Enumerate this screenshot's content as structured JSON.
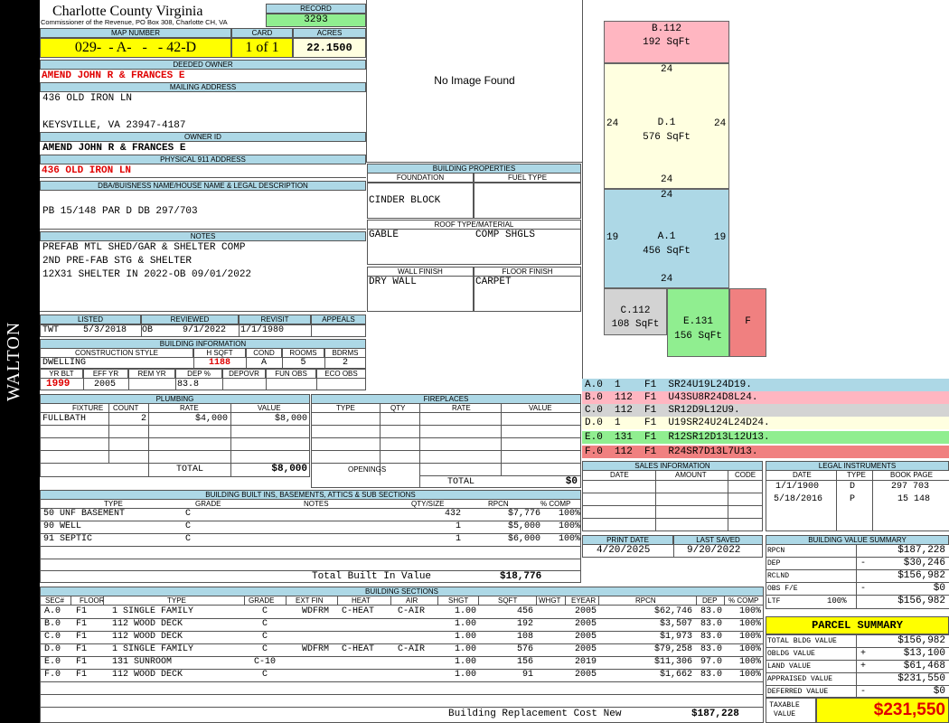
{
  "sidebar_label": "WALTON",
  "header": {
    "county": "Charlotte County Virginia",
    "office": "Commissioner of the Revenue, PO Box 308, Charlotte CH, VA",
    "record_label": "RECORD",
    "record_value": "3293",
    "map_number_label": "MAP NUMBER",
    "map_number": "029-  - A-   -   - 42-D",
    "card_label": "CARD",
    "card_value": "1 of 1",
    "acres_label": "ACRES",
    "acres_value": "22.1500"
  },
  "owner": {
    "deeded_owner_label": "DEEDED OWNER",
    "deeded_owner": "AMEND JOHN R & FRANCES E",
    "mailing_address_label": "MAILING ADDRESS",
    "mailing_line1": "436 OLD IRON LN",
    "mailing_line2": "KEYSVILLE, VA 23947-4187",
    "owner_id_label": "OWNER ID",
    "owner_id": "AMEND JOHN R & FRANCES E",
    "physical_address_label": "PHYSICAL 911 ADDRESS",
    "physical_address": "436 OLD IRON LN"
  },
  "legal": {
    "label": "DBA/BUISNESS NAME/HOUSE NAME & LEGAL DESCRIPTION",
    "text": "PB 15/148 PAR D DB 297/703"
  },
  "notes": {
    "label": "NOTES",
    "line1": "PREFAB MTL SHED/GAR & SHELTER COMP",
    "line2": "2ND PRE-FAB STG & SHELTER",
    "line3": "12X31 SHELTER IN 2022-OB 09/01/2022"
  },
  "image": {
    "text": "No Image Found"
  },
  "building_properties": {
    "label": "BUILDING PROPERTIES",
    "foundation_label": "FOUNDATION",
    "fuel_type_label": "FUEL TYPE",
    "foundation": "CINDER BLOCK",
    "roof_label": "ROOF TYPE/MATERIAL",
    "roof_type": "GABLE",
    "roof_material": "COMP SHGLS",
    "wall_label": "WALL FINISH",
    "floor_label": "FLOOR FINISH",
    "wall": "DRY WALL",
    "floor": "CARPET"
  },
  "dates": {
    "listed_label": "LISTED",
    "reviewed_label": "REVIEWED",
    "revisit_label": "REVISIT",
    "appeals_label": "APPEALS",
    "listed_by": "TWT",
    "listed": "5/3/2018",
    "reviewed_by": "OB",
    "reviewed": "9/1/2022",
    "revisit": "1/1/1980"
  },
  "building_info": {
    "label": "BUILDING INFORMATION",
    "construction_label": "CONSTRUCTION STYLE",
    "hsqft_label": "H SQFT",
    "cond_label": "COND",
    "rooms_label": "ROOMS",
    "bdrms_label": "BDRMS",
    "construction": "DWELLING",
    "hsqft": "1188",
    "cond": "A",
    "rooms": "5",
    "bdrms": "2",
    "yrblt_label": "YR BLT",
    "effyr_label": "EFF YR",
    "remyr_label": "REM YR",
    "dep_label": "DEP %",
    "depovr_label": "DEPOVR",
    "funobs_label": "FUN OBS",
    "ecoobs_label": "ECO OBS",
    "yrblt": "1999",
    "effyr": "2005",
    "dep": "83.8"
  },
  "plumbing": {
    "label": "PLUMBING",
    "headers": [
      "FIXTURE",
      "COUNT",
      "RATE",
      "VALUE"
    ],
    "rows": [
      [
        "FULLBATH",
        "2",
        "$4,000",
        "$8,000"
      ]
    ],
    "total_label": "TOTAL",
    "total": "$8,000"
  },
  "fireplaces": {
    "label": "FIREPLACES",
    "headers": [
      "TYPE",
      "QTY",
      "RATE",
      "VALUE"
    ],
    "openings_label": "OPENINGS",
    "total_label": "TOTAL",
    "total": "$0"
  },
  "built_ins": {
    "label": "BUILDING BUILT INS, BASEMENTS, ATTICS & SUB SECTIONS",
    "headers": [
      "TYPE",
      "GRADE",
      "NOTES",
      "QTY/SIZE",
      "RPCN",
      "% COMP"
    ],
    "rows": [
      [
        "50 UNF BASEMENT",
        "C",
        "",
        "432",
        "$7,776",
        "100%"
      ],
      [
        "90 WELL",
        "C",
        "",
        "1",
        "$5,000",
        "100%"
      ],
      [
        "91 SEPTIC",
        "C",
        "",
        "1",
        "$6,000",
        "100%"
      ]
    ],
    "total_label": "Total Built In Value",
    "total": "$18,776"
  },
  "sections": {
    "label": "BUILDING SECTIONS",
    "headers": [
      "SEC#",
      "FLOOR",
      "TYPE",
      "GRADE",
      "EXT FIN",
      "HEAT",
      "AIR",
      "SHGT",
      "SQFT",
      "WHGT",
      "EYEAR",
      "RPCN",
      "DEP",
      "% COMP"
    ],
    "rows": [
      [
        "A.0",
        "F1",
        "1 SINGLE FAMILY",
        "C",
        "WDFRM",
        "C-HEAT",
        "C-AIR",
        "1.00",
        "456",
        "",
        "2005",
        "$62,746",
        "83.0",
        "100%"
      ],
      [
        "B.0",
        "F1",
        "112 WOOD DECK",
        "C",
        "",
        "",
        "",
        "1.00",
        "192",
        "",
        "2005",
        "$3,507",
        "83.0",
        "100%"
      ],
      [
        "C.0",
        "F1",
        "112 WOOD DECK",
        "C",
        "",
        "",
        "",
        "1.00",
        "108",
        "",
        "2005",
        "$1,973",
        "83.0",
        "100%"
      ],
      [
        "D.0",
        "F1",
        "1 SINGLE FAMILY",
        "C",
        "WDFRM",
        "C-HEAT",
        "C-AIR",
        "1.00",
        "576",
        "",
        "2005",
        "$79,258",
        "83.0",
        "100%"
      ],
      [
        "E.0",
        "F1",
        "131 SUNROOM",
        "C-10",
        "",
        "",
        "",
        "1.00",
        "156",
        "",
        "2019",
        "$11,306",
        "97.0",
        "100%"
      ],
      [
        "F.0",
        "F1",
        "112 WOOD DECK",
        "C",
        "",
        "",
        "",
        "1.00",
        "91",
        "",
        "2005",
        "$1,662",
        "83.0",
        "100%"
      ]
    ],
    "replacement_label": "Building Replacement Cost New",
    "replacement": "$187,228"
  },
  "sketch": {
    "areas": [
      {
        "id": "B.112",
        "sqft": "192 SqFt",
        "color": "#ffb6c1"
      },
      {
        "id": "D.1",
        "sqft": "576 SqFt",
        "color": "#ffffe0"
      },
      {
        "id": "A.1",
        "sqft": "456 SqFt",
        "color": "#add8e6"
      },
      {
        "id": "C.112",
        "sqft": "108 SqFt",
        "color": "#d3d3d3"
      },
      {
        "id": "E.131",
        "sqft": "156 SqFt",
        "color": "#90ee90"
      },
      {
        "id": "F",
        "sqft": "",
        "color": "#f08080"
      }
    ],
    "dims": {
      "d_top": "24",
      "d_left": "24",
      "d_right": "24",
      "d_bottom": "24",
      "a_top": "24",
      "a_left": "19",
      "a_right": "19",
      "a_bottom": "24"
    },
    "segments": [
      {
        "text": "A.0  1    F1  SR24U19L24D19.",
        "color": "#add8e6"
      },
      {
        "text": "B.0  112  F1  U43SU8R24D8L24.",
        "color": "#ffb6c1"
      },
      {
        "text": "C.0  112  F1  SR12D9L12U9.",
        "color": "#d3d3d3"
      },
      {
        "text": "D.0  1    F1  U19SR24U24L24D24.",
        "color": "#ffffe0"
      },
      {
        "text": "E.0  131  F1  R12SR12D13L12U13.",
        "color": "#90ee90"
      },
      {
        "text": "F.0  112  F1  R24SR7D13L7U13.",
        "color": "#f08080"
      }
    ]
  },
  "sales": {
    "label": "SALES INFORMATION",
    "headers": [
      "DATE",
      "AMOUNT",
      "CODE"
    ]
  },
  "legal_instruments": {
    "label": "LEGAL INSTRUMENTS",
    "headers": [
      "DATE",
      "TYPE",
      "BOOK PAGE"
    ],
    "rows": [
      [
        "1/1/1900",
        "D",
        "297 703"
      ],
      [
        "5/18/2016",
        "P",
        "15 148"
      ]
    ]
  },
  "print": {
    "print_date_label": "PRINT DATE",
    "last_saved_label": "LAST SAVED",
    "print_date": "4/20/2025",
    "last_saved": "9/20/2022"
  },
  "value_summary": {
    "label": "BUILDING VALUE SUMMARY",
    "rows": [
      {
        "label": "RPCN",
        "sign": "",
        "value": "$187,228"
      },
      {
        "label": "DEP",
        "sign": "-",
        "value": "$30,246"
      },
      {
        "label": "RCLND",
        "sign": "",
        "value": "$156,982"
      },
      {
        "label": "OBS F/E",
        "sign": "-",
        "value": "$0"
      },
      {
        "label": "LTF",
        "extra": "100%",
        "sign": "",
        "value": "$156,982"
      }
    ]
  },
  "parcel": {
    "label": "PARCEL SUMMARY",
    "rows": [
      {
        "label": "TOTAL BLDG VALUE",
        "sign": "",
        "value": "$156,982"
      },
      {
        "label": "OBLDG VALUE",
        "sign": "+",
        "value": "$13,100"
      },
      {
        "label": "LAND VALUE",
        "sign": "+",
        "value": "$61,468"
      },
      {
        "label": "APPRAISED VALUE",
        "sign": "",
        "value": "$231,550"
      },
      {
        "label": "DEFERRED VALUE",
        "sign": "-",
        "value": "$0"
      }
    ],
    "taxable_label": "TAXABLE VALUE",
    "taxable_value": "$231,550"
  },
  "colors": {
    "yellow": "#ffff00",
    "green": "#90ee90",
    "header_blue": "#add8e6",
    "red_text": "#e00000"
  }
}
